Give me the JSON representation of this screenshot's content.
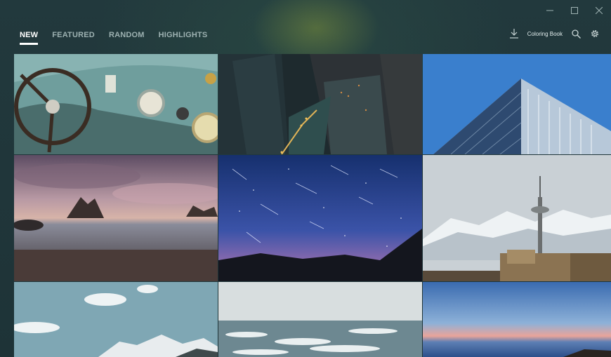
{
  "window": {
    "minimize_icon": "minimize-icon",
    "maximize_icon": "maximize-icon",
    "close_icon": "close-icon"
  },
  "nav": {
    "tabs": [
      {
        "label": "NEW",
        "active": true
      },
      {
        "label": "FEATURED",
        "active": false
      },
      {
        "label": "RANDOM",
        "active": false
      },
      {
        "label": "HIGHLIGHTS",
        "active": false
      }
    ]
  },
  "toolbar": {
    "download_icon": "download-icon",
    "collection_label": "Coloring Book",
    "search_icon": "search-icon",
    "settings_icon": "gear-icon"
  },
  "colors": {
    "background": "#1f3a3c",
    "active_tab": "#ffffff",
    "inactive_tab": "#9db1b1"
  },
  "gallery": {
    "photos": [
      {
        "subject": "vintage car dashboard"
      },
      {
        "subject": "city skyscrapers at night"
      },
      {
        "subject": "modern building against blue sky"
      },
      {
        "subject": "rocky beach at dusk"
      },
      {
        "subject": "meteor shower night sky"
      },
      {
        "subject": "snowy mountains with tower"
      },
      {
        "subject": "clouds and snowy peaks"
      },
      {
        "subject": "icy sea"
      },
      {
        "subject": "sunset horizon over sea"
      }
    ]
  }
}
